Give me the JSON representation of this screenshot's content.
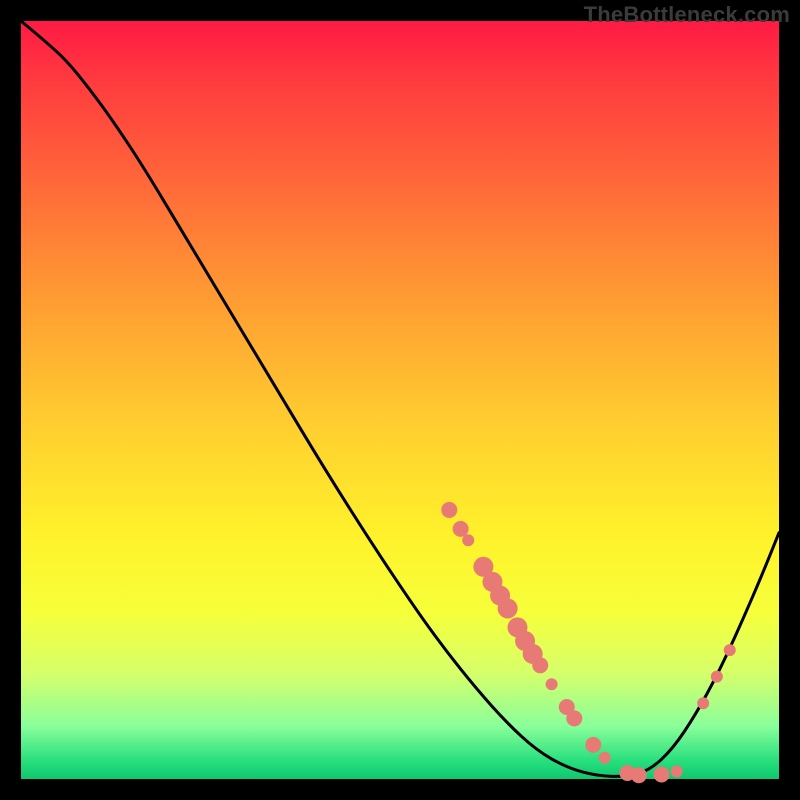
{
  "watermark": "TheBottleneck.com",
  "colors": {
    "curve_stroke": "#000000",
    "marker_fill": "#e77a74",
    "marker_stroke": "#d66c66"
  },
  "chart_data": {
    "type": "line",
    "title": "",
    "xlabel": "",
    "ylabel": "",
    "xlim": [
      0,
      100
    ],
    "ylim": [
      0,
      100
    ],
    "grid": false,
    "curve": [
      {
        "x": 0.0,
        "y": 100.0
      },
      {
        "x": 3.0,
        "y": 97.5
      },
      {
        "x": 6.0,
        "y": 94.8
      },
      {
        "x": 9.0,
        "y": 91.1
      },
      {
        "x": 12.0,
        "y": 87.0
      },
      {
        "x": 16.0,
        "y": 81.0
      },
      {
        "x": 22.0,
        "y": 71.0
      },
      {
        "x": 28.0,
        "y": 61.0
      },
      {
        "x": 34.0,
        "y": 51.0
      },
      {
        "x": 40.0,
        "y": 41.0
      },
      {
        "x": 46.0,
        "y": 31.5
      },
      {
        "x": 52.0,
        "y": 22.5
      },
      {
        "x": 56.0,
        "y": 17.0
      },
      {
        "x": 60.0,
        "y": 12.0
      },
      {
        "x": 64.0,
        "y": 7.5
      },
      {
        "x": 68.0,
        "y": 3.8
      },
      {
        "x": 72.0,
        "y": 1.5
      },
      {
        "x": 76.0,
        "y": 0.4
      },
      {
        "x": 80.0,
        "y": 0.3
      },
      {
        "x": 83.0,
        "y": 1.2
      },
      {
        "x": 86.0,
        "y": 4.0
      },
      {
        "x": 89.0,
        "y": 8.5
      },
      {
        "x": 92.0,
        "y": 14.0
      },
      {
        "x": 95.0,
        "y": 20.5
      },
      {
        "x": 98.0,
        "y": 27.5
      },
      {
        "x": 100.0,
        "y": 32.5
      }
    ],
    "markers": [
      {
        "x": 56.5,
        "y": 35.5,
        "r": 8
      },
      {
        "x": 58.0,
        "y": 33.0,
        "r": 8
      },
      {
        "x": 59.0,
        "y": 31.5,
        "r": 6
      },
      {
        "x": 61.0,
        "y": 28.0,
        "r": 10
      },
      {
        "x": 62.2,
        "y": 26.0,
        "r": 10
      },
      {
        "x": 63.2,
        "y": 24.2,
        "r": 10
      },
      {
        "x": 64.2,
        "y": 22.5,
        "r": 10
      },
      {
        "x": 65.5,
        "y": 20.0,
        "r": 10
      },
      {
        "x": 66.5,
        "y": 18.2,
        "r": 10
      },
      {
        "x": 67.5,
        "y": 16.5,
        "r": 10
      },
      {
        "x": 68.5,
        "y": 15.0,
        "r": 8
      },
      {
        "x": 70.0,
        "y": 12.5,
        "r": 6
      },
      {
        "x": 72.0,
        "y": 9.5,
        "r": 8
      },
      {
        "x": 73.0,
        "y": 8.0,
        "r": 8
      },
      {
        "x": 75.5,
        "y": 4.5,
        "r": 8
      },
      {
        "x": 77.0,
        "y": 2.8,
        "r": 6
      },
      {
        "x": 80.0,
        "y": 0.8,
        "r": 8
      },
      {
        "x": 81.5,
        "y": 0.5,
        "r": 8
      },
      {
        "x": 84.5,
        "y": 0.6,
        "r": 8
      },
      {
        "x": 86.5,
        "y": 1.0,
        "r": 6
      },
      {
        "x": 90.0,
        "y": 10.0,
        "r": 6
      },
      {
        "x": 91.8,
        "y": 13.5,
        "r": 6
      },
      {
        "x": 93.5,
        "y": 17.0,
        "r": 6
      }
    ]
  }
}
